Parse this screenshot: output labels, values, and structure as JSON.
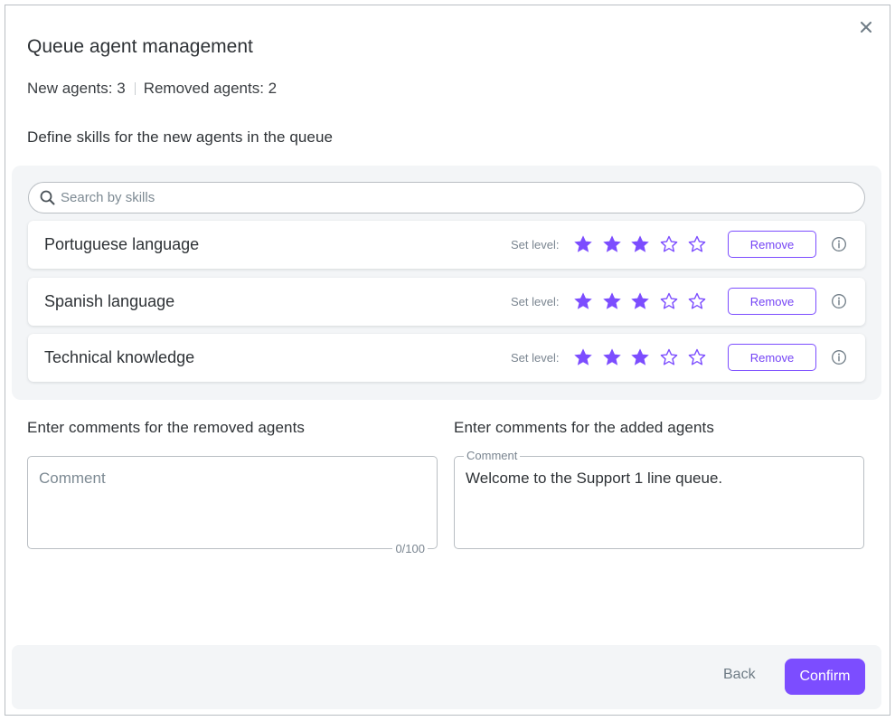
{
  "dialog": {
    "title": "Queue agent management",
    "close_icon": "close-icon",
    "counts": {
      "new": "New agents: 3",
      "removed": "Removed agents: 2"
    }
  },
  "skills_section": {
    "heading": "Define skills for the new agents in the queue",
    "search_placeholder": "Search by skills",
    "search_icon": "search-icon",
    "set_level_label": "Set level:",
    "max_level": 5,
    "remove_label": "Remove",
    "info_icon": "info-icon",
    "skills": [
      {
        "name": "Portuguese language",
        "level": 3
      },
      {
        "name": "Spanish language",
        "level": 3
      },
      {
        "name": "Technical knowledge",
        "level": 3
      }
    ]
  },
  "removed_comments": {
    "heading": "Enter comments for the removed agents",
    "placeholder": "Comment",
    "value": "",
    "counter": "0/100"
  },
  "added_comments": {
    "heading": "Enter comments for the added agents",
    "label": "Comment",
    "value": "Welcome to the Support 1 line queue."
  },
  "footer": {
    "back_label": "Back",
    "confirm_label": "Confirm"
  },
  "colors": {
    "accent": "#7c4dff",
    "border": "#b9bec3",
    "panel_bg": "#f3f5f7"
  }
}
